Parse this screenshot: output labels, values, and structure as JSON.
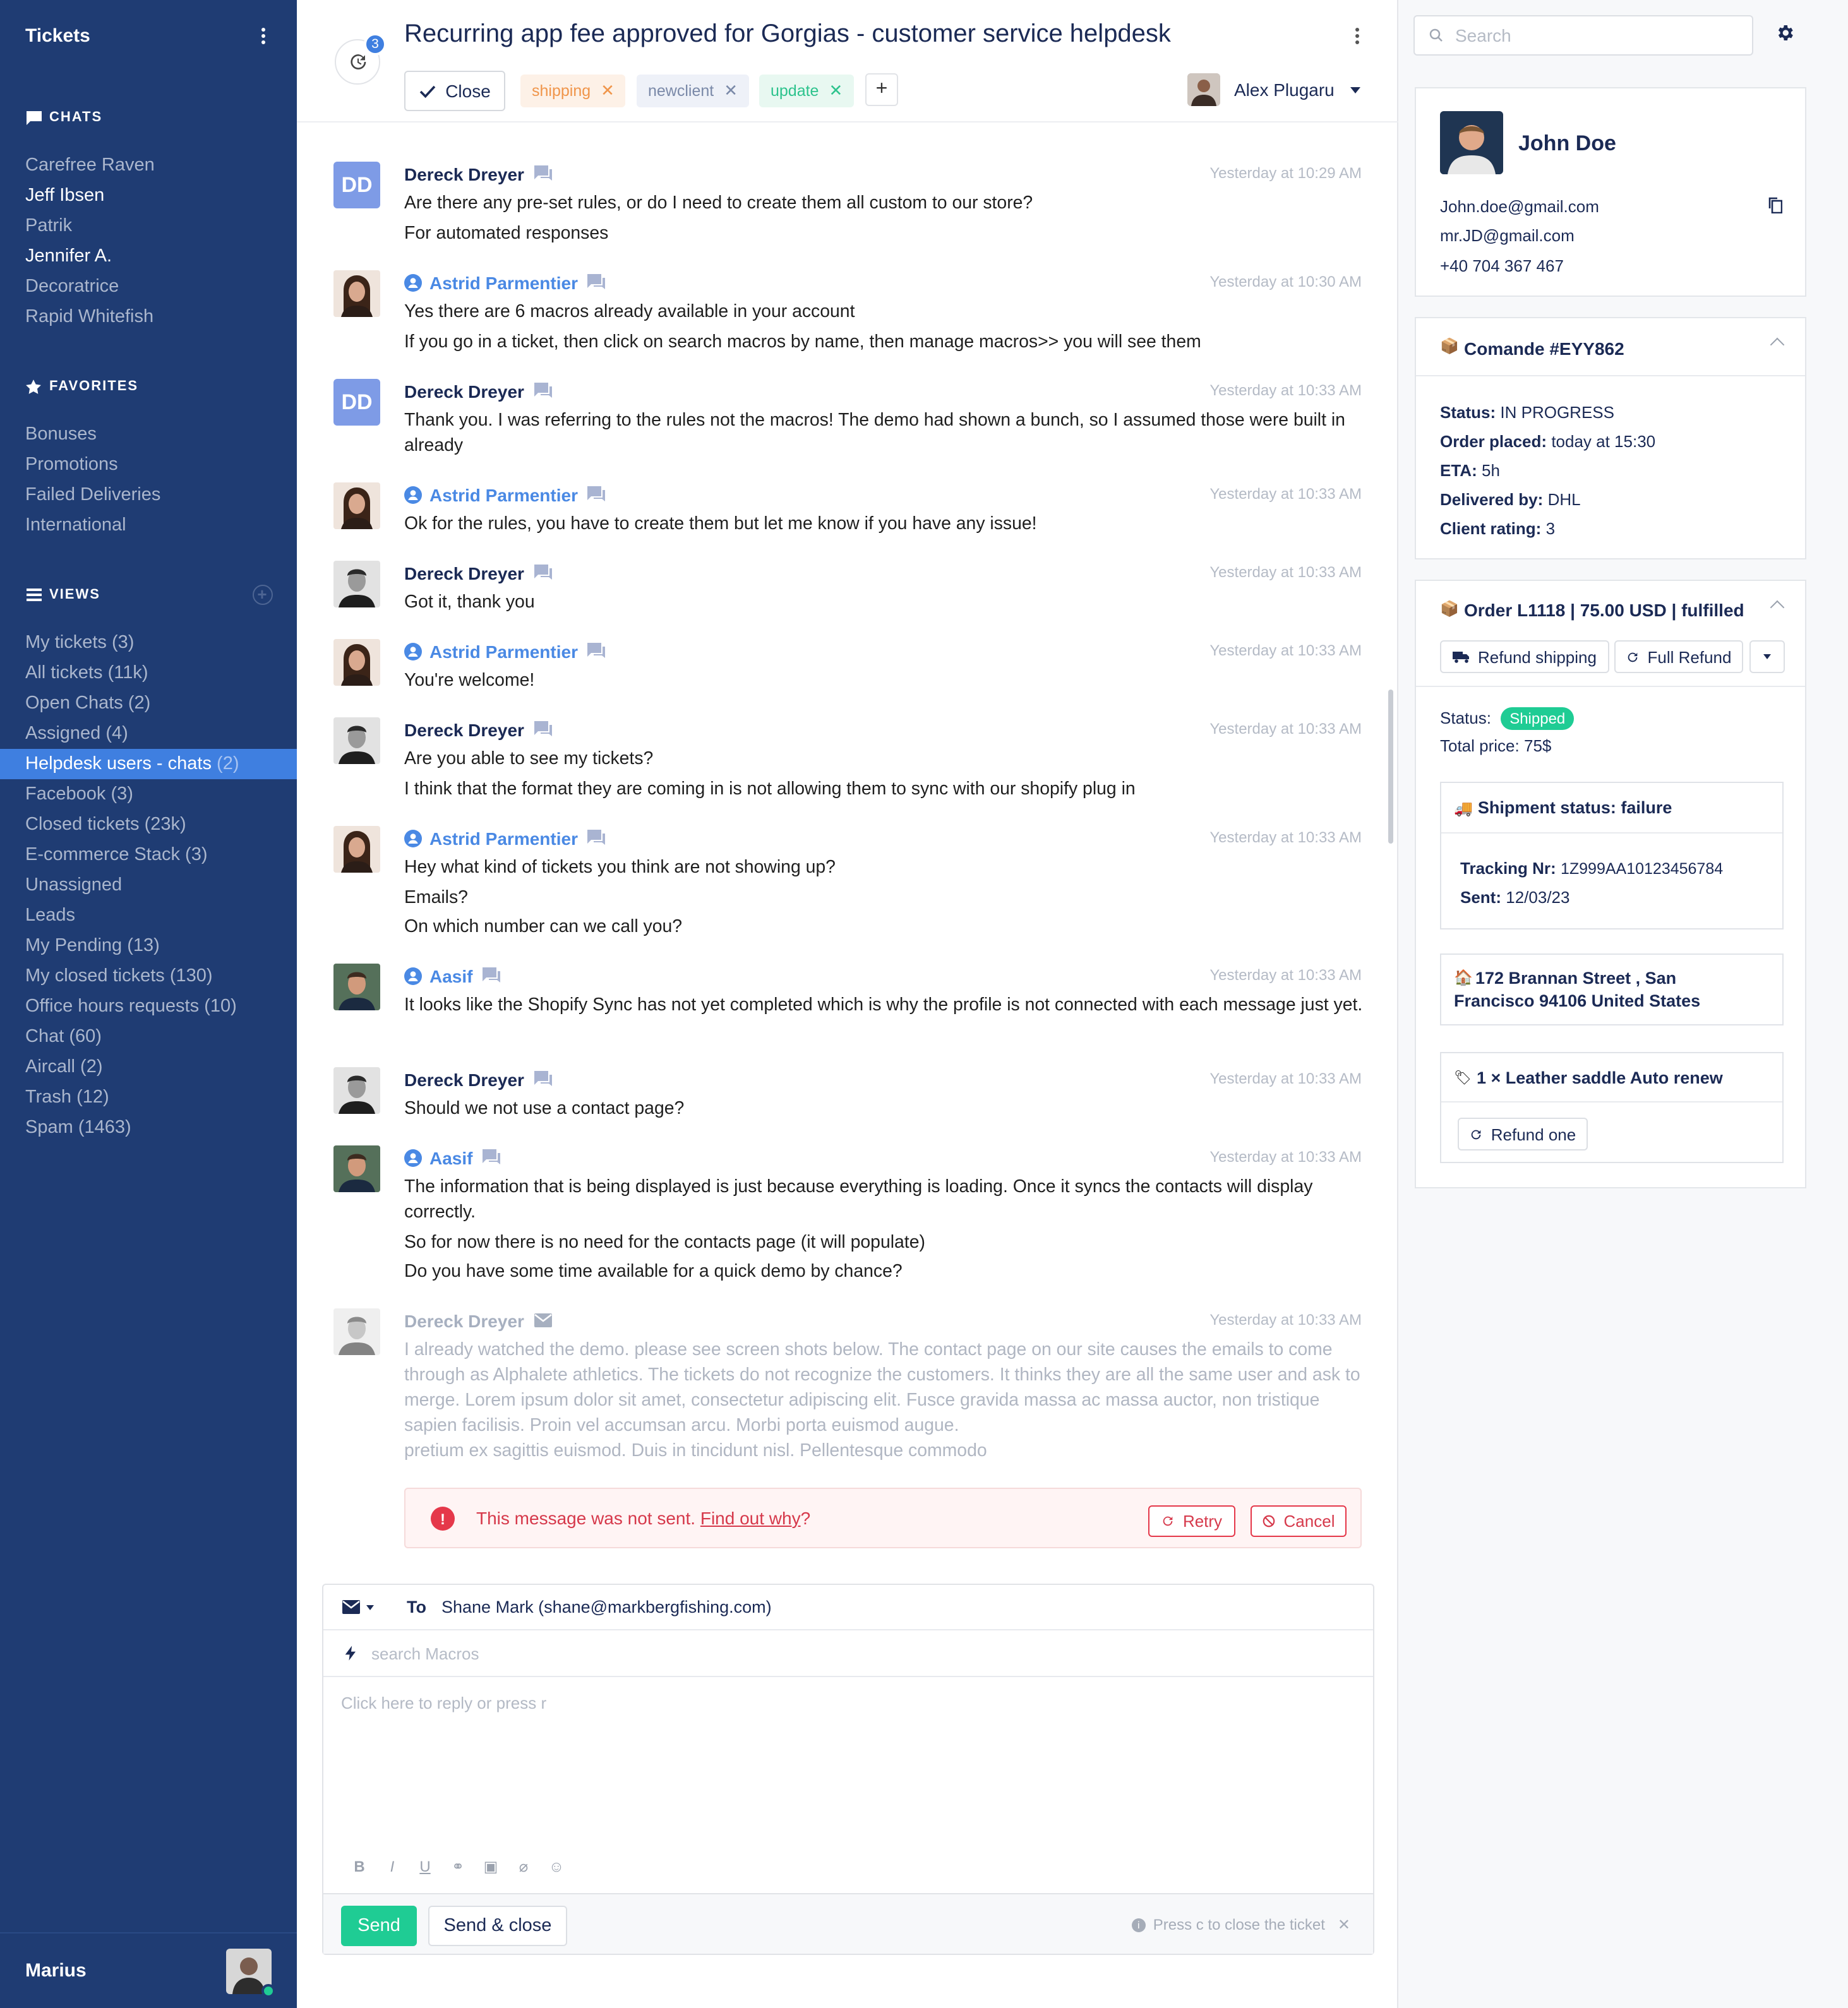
{
  "sidebar": {
    "title": "Tickets",
    "sections": {
      "chats": "CHATS",
      "favorites": "FAVORITES",
      "views": "VIEWS"
    },
    "chats": [
      "Carefree Raven",
      "Jeff Ibsen",
      "Patrik",
      "Jennifer A.",
      "Decoratrice",
      "Rapid Whitefish"
    ],
    "favorites": [
      "Bonuses",
      "Promotions",
      "Failed Deliveries",
      "International"
    ],
    "views": [
      {
        "label": "My tickets",
        "count": "(3)"
      },
      {
        "label": "All tickets",
        "count": "(11k)"
      },
      {
        "label": "Open Chats",
        "count": "(2)"
      },
      {
        "label": "Assigned",
        "count": "(4)"
      },
      {
        "label": "Helpdesk users - chats",
        "count": "(2)"
      },
      {
        "label": "Facebook",
        "count": "(3)"
      },
      {
        "label": "Closed tickets",
        "count": "(23k)"
      },
      {
        "label": "E-commerce Stack",
        "count": "(3)"
      },
      {
        "label": "Unassigned",
        "count": ""
      },
      {
        "label": "Leads",
        "count": ""
      },
      {
        "label": "My Pending",
        "count": "(13)"
      },
      {
        "label": "My closed tickets",
        "count": "(130)"
      },
      {
        "label": "Office hours requests",
        "count": "(10)"
      },
      {
        "label": "Chat",
        "count": "(60)"
      },
      {
        "label": "Aircall",
        "count": "(2)"
      },
      {
        "label": "Trash",
        "count": "(12)"
      },
      {
        "label": "Spam",
        "count": "(1463)"
      }
    ],
    "user": "Marius"
  },
  "ticket": {
    "subject": "Recurring app fee approved for Gorgias - customer service helpdesk",
    "history_count": "3",
    "close_label": "Close",
    "tags": [
      "shipping",
      "newclient",
      "update"
    ],
    "assignee": "Alex Plugaru"
  },
  "messages": [
    {
      "author": "Dereck Dreyer",
      "time": "Yesterday at 10:29 AM",
      "lines": [
        "Are there any pre-set rules, or do I need to create them all custom to our store?",
        "For automated responses"
      ]
    },
    {
      "author": "Astrid Parmentier",
      "time": "Yesterday at 10:30 AM",
      "lines": [
        "Yes there are 6 macros already available in your account",
        "If you go in a ticket, then click on search macros by name, then manage macros>> you will see them"
      ]
    },
    {
      "author": "Dereck Dreyer",
      "time": "Yesterday at 10:33 AM",
      "lines": [
        "Thank you. I was referring to the rules not the macros! The demo had shown a bunch, so I assumed those were built in already"
      ]
    },
    {
      "author": "Astrid Parmentier",
      "time": "Yesterday at 10:33 AM",
      "lines": [
        "Ok for the rules, you have to create them but let me know if you have any issue!"
      ]
    },
    {
      "author": "Dereck Dreyer",
      "time": "Yesterday at 10:33 AM",
      "lines": [
        "Got it, thank you"
      ]
    },
    {
      "author": "Astrid Parmentier",
      "time": "Yesterday at 10:33 AM",
      "lines": [
        "You're welcome!"
      ]
    },
    {
      "author": "Dereck Dreyer",
      "time": "Yesterday at 10:33 AM",
      "lines": [
        "Are you able to see my tickets?",
        "I think that the format they are coming in is not allowing them to sync with our shopify plug in"
      ]
    },
    {
      "author": "Astrid Parmentier",
      "time": "Yesterday at 10:33 AM",
      "lines": [
        "Hey what kind of tickets you think are not showing up?",
        "Emails?",
        "On which number can we call you?"
      ]
    },
    {
      "author": "Aasif",
      "time": "Yesterday at 10:33 AM",
      "lines": [
        "It looks like the Shopify Sync has not yet completed which is why the profile is not connected with each message just yet."
      ]
    },
    {
      "author": "Dereck Dreyer",
      "time": "Yesterday at 10:33 AM",
      "lines": [
        "Should we not use a contact page?"
      ]
    },
    {
      "author": "Aasif",
      "time": "Yesterday at 10:33 AM",
      "lines": [
        "The information that is being displayed is just because everything is loading. Once it syncs the contacts will display correctly.",
        "So for now there is no need for the contacts page (it will populate)",
        "Do you have some time available for a quick demo by chance?"
      ]
    },
    {
      "author": "Dereck Dreyer",
      "time": "Yesterday at 10:33 AM",
      "lines": [
        "I already watched the demo. please see screen shots below. The contact page on our site causes the emails to come through as Alphalete athletics. The tickets do not recognize the customers. It thinks they are all the same user and ask to merge.  Lorem ipsum dolor sit amet, consectetur adipiscing elit. Fusce gravida massa ac massa auctor, non tristique sapien facilisis. Proin vel accumsan arcu. Morbi porta euismod augue.\npretium ex sagittis euismod. Duis in tincidunt nisl. Pellentesque commodo"
      ]
    }
  ],
  "error": {
    "text": "This message was not sent.",
    "link": "Find out why",
    "suffix": "?",
    "retry": "Retry",
    "cancel": "Cancel"
  },
  "composer": {
    "to_label": "To",
    "to_value": "Shane Mark (shane@markbergfishing.com)",
    "macros_placeholder": "search Macros",
    "reply_placeholder": "Click here to reply or press r",
    "send": "Send",
    "send_close": "Send & close",
    "hint": "Press c to close the ticket"
  },
  "customer": {
    "search_placeholder": "Search",
    "name": "John Doe",
    "emails": [
      "John.doe@gmail.com",
      "mr.JD@gmail.com"
    ],
    "phone": "+40 704 367 467"
  },
  "comande": {
    "title": "Comande #EYY862",
    "fields": [
      {
        "k": "Status:",
        "v": "IN PROGRESS"
      },
      {
        "k": "Order placed:",
        "v": "today at 15:30"
      },
      {
        "k": "ETA:",
        "v": "5h"
      },
      {
        "k": "Delivered by:",
        "v": "DHL"
      },
      {
        "k": "Client rating:",
        "v": "3"
      }
    ]
  },
  "order": {
    "title": "Order L1118 | 75.00 USD | fulfilled",
    "refund_shipping": "Refund shipping",
    "full_refund": "Full Refund",
    "status_label": "Status:",
    "status_value": "Shipped",
    "total_label": "Total price:",
    "total_value": "75$",
    "shipment_title": "Shipment status: failure",
    "tracking_label": "Tracking Nr:",
    "tracking_value": "1Z999AA10123456784",
    "sent_label": "Sent:",
    "sent_value": "12/03/23",
    "address": "172 Brannan Street , San Francisco 94106 United States",
    "item": "1 × Leather saddle Auto renew",
    "refund_one": "Refund one"
  }
}
